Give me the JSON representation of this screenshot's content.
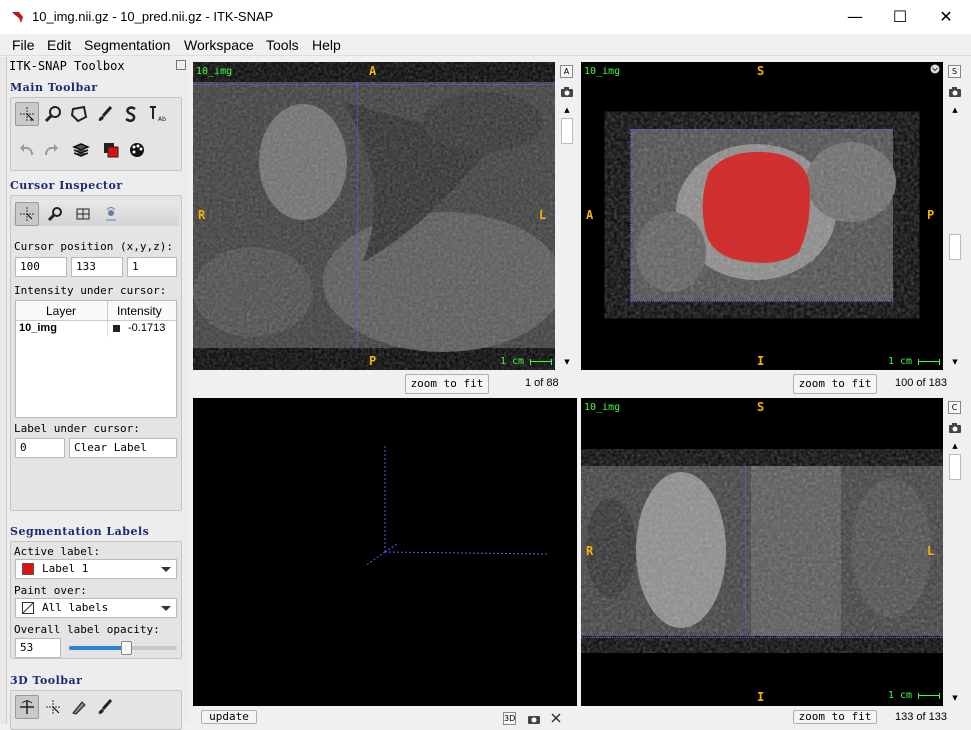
{
  "window": {
    "title": "10_img.nii.gz - 10_pred.nii.gz - ITK-SNAP",
    "minimize": "—",
    "maximize": "☐",
    "close": "✕"
  },
  "menu": [
    "File",
    "Edit",
    "Segmentation",
    "Workspace",
    "Tools",
    "Help"
  ],
  "toolbox": {
    "title": "ITK-SNAP Toolbox",
    "main_toolbar": "Main Toolbar",
    "cursor_inspector": "Cursor Inspector",
    "cursor_position_label": "Cursor position (x,y,z):",
    "cursor_x": "100",
    "cursor_y": "133",
    "cursor_z": "1",
    "intensity_label": "Intensity under cursor:",
    "table_headers": [
      "Layer",
      "Intensity"
    ],
    "table_rows": [
      {
        "layer": "10_img",
        "intensity": "-0.1713"
      }
    ],
    "label_under_cursor": "Label under cursor:",
    "label_id": "0",
    "label_name": "Clear Label",
    "segmentation_labels": "Segmentation Labels",
    "active_label_caption": "Active label:",
    "active_label": "Label 1",
    "active_label_color": "#e01010",
    "paint_over_caption": "Paint over:",
    "paint_over": "All labels",
    "opacity_caption": "Overall label opacity:",
    "opacity_value": "53",
    "opacity_fraction": 0.53,
    "toolbar_3d": "3D Toolbar"
  },
  "views": {
    "axial": {
      "layer": "10_img",
      "top": "A",
      "bottom": "P",
      "left": "R",
      "right": "L",
      "scale": "1 cm",
      "slice": "1 of 88",
      "zoom": "zoom to fit",
      "side_btn": "A"
    },
    "sagittal": {
      "layer": "10_img",
      "top": "S",
      "bottom": "I",
      "left": "A",
      "right": "P",
      "scale": "1 cm",
      "slice": "100 of 183",
      "zoom": "zoom to fit",
      "side_btn": "S"
    },
    "coronal": {
      "layer": "10_img",
      "top": "S",
      "bottom": "I",
      "left": "R",
      "right": "L",
      "scale": "1 cm",
      "slice": "133 of 133",
      "zoom": "zoom to fit",
      "side_btn": "C"
    },
    "render3d": {
      "update": "update",
      "mode": "3D"
    }
  },
  "colors": {
    "accent_title": "#1b2a7a",
    "orientation": "#f5b300",
    "overlay_green": "#3cff3c",
    "crosshair": "#5a5aff",
    "segmentation": "#d42a2a"
  }
}
